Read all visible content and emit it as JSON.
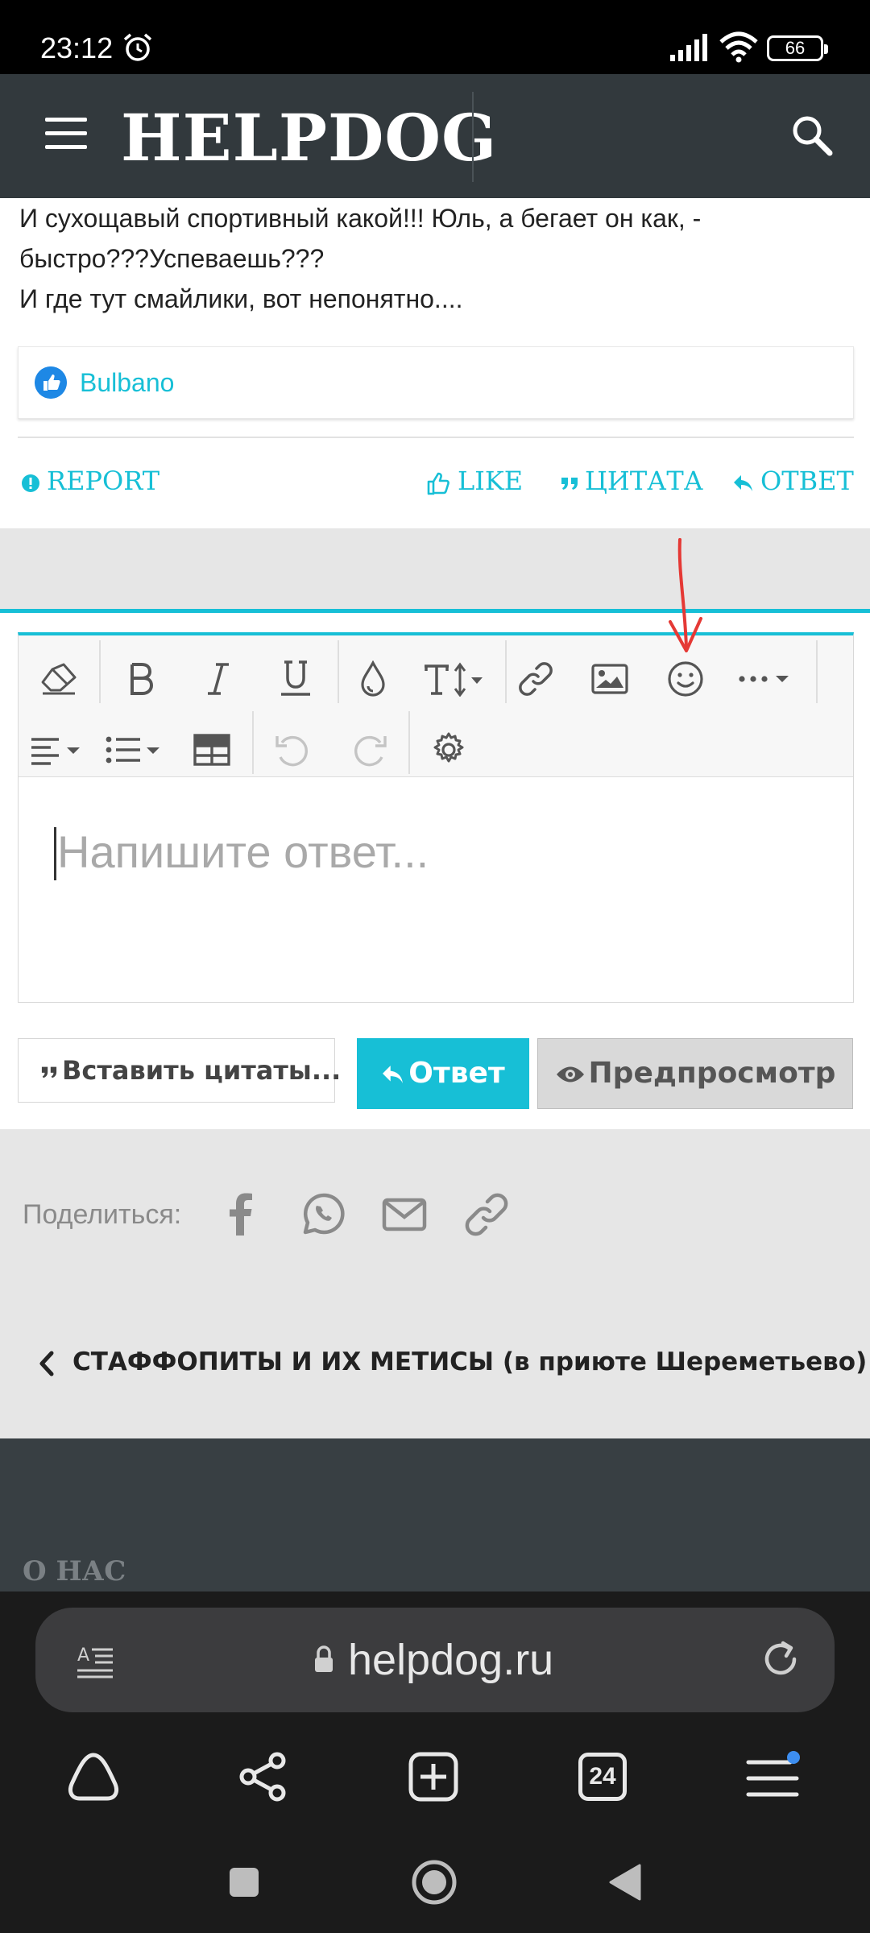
{
  "status_bar": {
    "time": "23:12",
    "battery": "66"
  },
  "header": {
    "logo": "HELPDOG"
  },
  "post": {
    "lines": [
      "И сухощавый спортивный какой!!! Юль, а бегает он как, -",
      "быстро???Успеваешь???",
      "И где тут смайлики, вот непонятно...."
    ],
    "liked_by": "Bulbano",
    "actions": {
      "report": "REPORT",
      "like": "LIKE",
      "quote": "ЦИТАТА",
      "reply": "ОТВЕТ"
    }
  },
  "editor": {
    "placeholder": "Напишите ответ...",
    "insert_quotes": "Вставить цитаты...",
    "submit": "Ответ",
    "preview": "Предпросмотр"
  },
  "share": {
    "label": "Поделиться:"
  },
  "breadcrumb": {
    "label": "СТАФФОПИТЫ И ИХ МЕТИСЫ (в приюте Шереметьево)"
  },
  "footer": {
    "title": "О НАС"
  },
  "browser": {
    "url": "helpdog.ru",
    "tabs_count": "24"
  },
  "colors": {
    "accent": "#17bfd6",
    "header_bg": "#32393d",
    "annotation_arrow": "#e53935"
  }
}
